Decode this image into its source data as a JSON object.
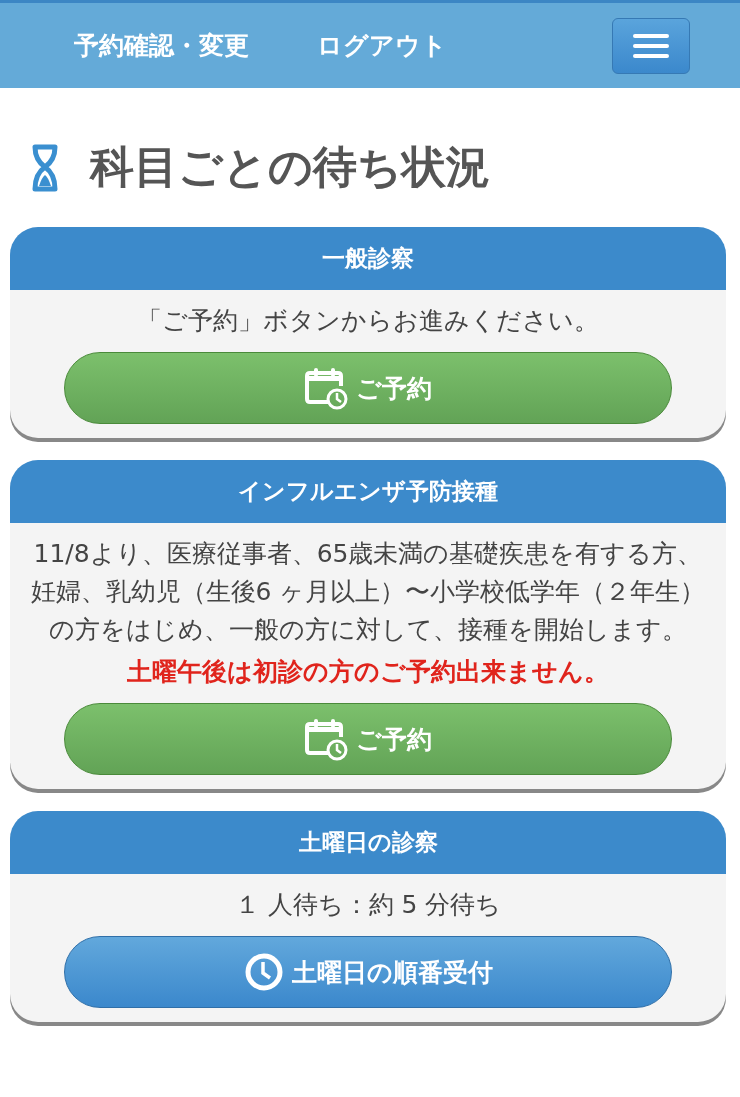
{
  "nav": {
    "links": [
      "予約確認・変更",
      "ログアウト"
    ]
  },
  "page": {
    "title": "科目ごとの待ち状況"
  },
  "cards": [
    {
      "title": "一般診察",
      "messages": [
        {
          "kind": "normal",
          "text": "「ご予約」ボタンからお進みください。"
        }
      ],
      "button": {
        "kind": "reserve",
        "label": "ご予約"
      }
    },
    {
      "title": "インフルエンザ予防接種",
      "messages": [
        {
          "kind": "normal",
          "text": "11/8より、医療従事者、65歳未満の基礎疾患を有する方、妊婦、乳幼児（生後6 ヶ月以上）〜小学校低学年（２年生）の方をはじめ、一般の方に対して、接種を開始します。"
        },
        {
          "kind": "alert",
          "text": "土曜午後は初診の方のご予約出来ません。"
        }
      ],
      "button": {
        "kind": "reserve",
        "label": "ご予約"
      }
    },
    {
      "title": "土曜日の診察",
      "messages": [
        {
          "kind": "normal",
          "text": "１ 人待ち：約 5 分待ち"
        }
      ],
      "button": {
        "kind": "queue",
        "label": "土曜日の順番受付"
      }
    }
  ]
}
